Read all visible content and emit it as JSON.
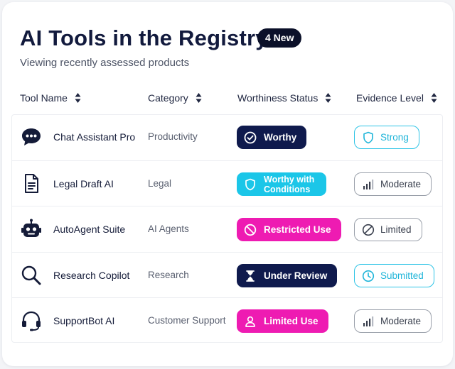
{
  "page": {
    "title": "AI Tools in the Registry",
    "badge": "4 New",
    "subtitle": "Viewing recently assessed products"
  },
  "columns": [
    {
      "label": "Tool Name"
    },
    {
      "label": "Category"
    },
    {
      "label": "Worthiness Status"
    },
    {
      "label": "Evidence Level"
    }
  ],
  "rows": [
    {
      "icon": "chat-bubble-icon",
      "name": "Chat Assistant Pro",
      "category": "Productivity",
      "status": {
        "label": "Worthy",
        "icon": "check-circle-icon",
        "color": "#0f1a4d"
      },
      "evidence": {
        "label": "Strong",
        "icon": "shield-icon",
        "style": "cyan"
      }
    },
    {
      "icon": "document-icon",
      "name": "Legal Draft AI",
      "category": "Legal",
      "status": {
        "label": "Worthy with Conditions",
        "icon": "shield-icon",
        "color": "#1bc6e8"
      },
      "evidence": {
        "label": "Moderate",
        "icon": "bar-chart-icon",
        "style": "gray"
      }
    },
    {
      "icon": "robot-icon",
      "name": "AutoAgent Suite",
      "category": "AI Agents",
      "status": {
        "label": "Restricted Use",
        "icon": "prohibited-icon",
        "color": "#ee1bb2"
      },
      "evidence": {
        "label": "Limited",
        "icon": "prohibited-icon",
        "style": "gray"
      }
    },
    {
      "icon": "magnifier-icon",
      "name": "Research Copilot",
      "category": "Research",
      "status": {
        "label": "Under Review",
        "icon": "hourglass-icon",
        "color": "#0f1a4d"
      },
      "evidence": {
        "label": "Submitted",
        "icon": "clock-icon",
        "style": "cyan"
      }
    },
    {
      "icon": "headset-icon",
      "name": "SupportBot AI",
      "category": "Customer Support",
      "status": {
        "label": "Limited Use",
        "icon": "user-icon",
        "color": "#ee1bb2"
      },
      "evidence": {
        "label": "Moderate",
        "icon": "bar-chart-icon",
        "style": "gray"
      }
    }
  ]
}
